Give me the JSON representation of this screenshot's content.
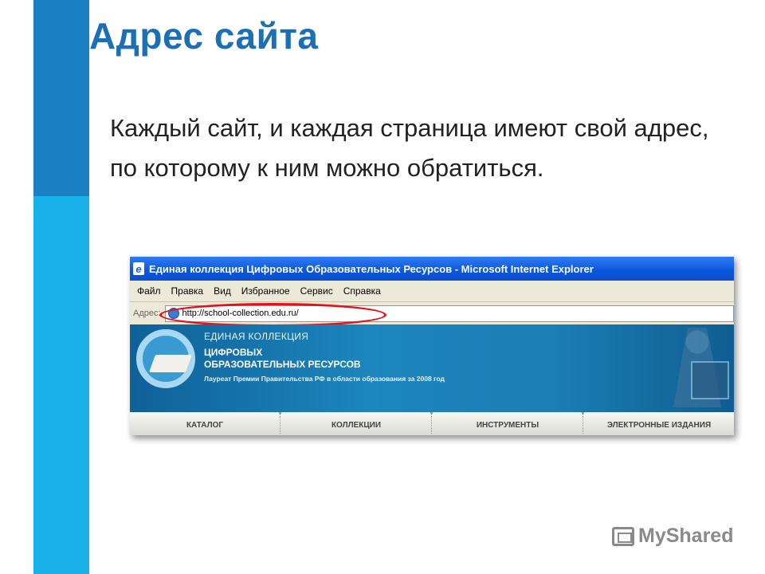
{
  "slide": {
    "title": "Адрес сайта",
    "text": "Каждый сайт, и каждая страница имеют свой адрес, по которому к ним можно обратиться."
  },
  "browser": {
    "title": "Единая коллекция Цифровых Образовательных Ресурсов - Microsoft Internet Explorer",
    "menu": [
      "Файл",
      "Правка",
      "Вид",
      "Избранное",
      "Сервис",
      "Справка"
    ],
    "address_label": "Адрес:",
    "address_value": "http://school-collection.edu.ru/",
    "banner": {
      "line1": "ЕДИНАЯ КОЛЛЕКЦИЯ",
      "line2a": "ЦИФРОВЫХ",
      "line2b": "ОБРАЗОВАТЕЛЬНЫХ РЕСУРСОВ",
      "line3": "Лауреат Премии Правительства РФ в области образования за 2008 год"
    },
    "nav": [
      "КАТАЛОГ",
      "КОЛЛЕКЦИИ",
      "ИНСТРУМЕНТЫ",
      "ЭЛЕКТРОННЫЕ ИЗДАНИЯ"
    ]
  },
  "watermark": "MyShared",
  "colors": {
    "title": "#1b6fb5",
    "bar_dark": "#1b7fc3",
    "bar_light": "#1ab1ea",
    "highlight_oval": "#e0121b"
  }
}
